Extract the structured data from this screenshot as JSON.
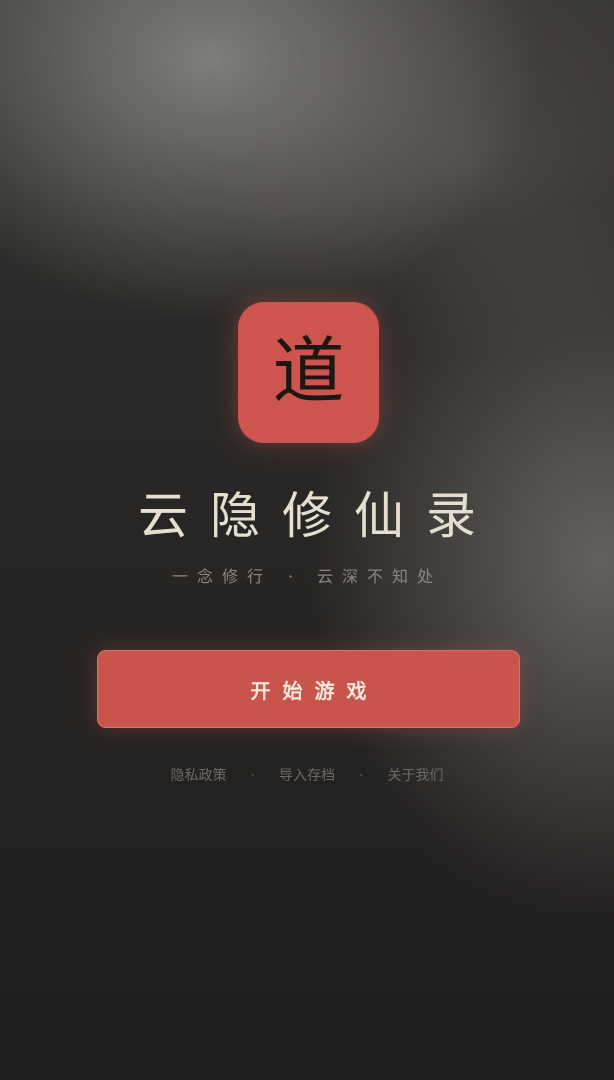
{
  "logo": {
    "char": "道",
    "color": "#cd554e"
  },
  "title": "云隐修仙录",
  "subtitle": {
    "left": "一念修行",
    "separator": "·",
    "right": "云深不知处"
  },
  "start_button": {
    "label": "开始游戏",
    "color": "#c9544c"
  },
  "links": {
    "privacy": "隐私政策",
    "separator": "·",
    "import_save": "导入存档",
    "about": "关于我们"
  }
}
